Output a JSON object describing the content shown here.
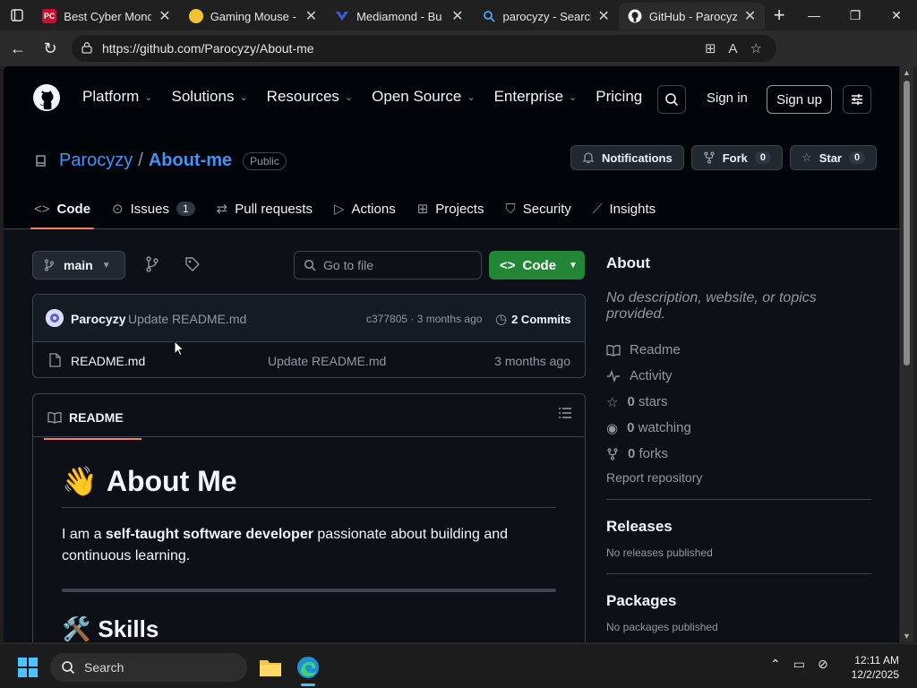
{
  "browser": {
    "tabs": [
      {
        "title": "Best Cyber Mond",
        "favicon": "pc-icon",
        "active": false
      },
      {
        "title": "Gaming Mouse -",
        "favicon": "lemon-icon",
        "active": false
      },
      {
        "title": "Mediamond - Bu",
        "favicon": "mediamond-icon",
        "active": false
      },
      {
        "title": "parocyzy - Search",
        "favicon": "search-icon",
        "active": false
      },
      {
        "title": "GitHub - Parocyz",
        "favicon": "github-icon",
        "active": true
      }
    ],
    "url": "https://github.com/Parocyzy/About-me"
  },
  "header": {
    "nav": [
      "Platform",
      "Solutions",
      "Resources",
      "Open Source",
      "Enterprise",
      "Pricing"
    ],
    "sign_in": "Sign in",
    "sign_up": "Sign up"
  },
  "repo": {
    "owner": "Parocyzy",
    "name": "About-me",
    "visibility": "Public",
    "notifications_label": "Notifications",
    "fork_label": "Fork",
    "fork_count": "0",
    "star_label": "Star",
    "star_count": "0",
    "tabs": [
      {
        "label": "Code",
        "icon": "code-icon",
        "count": ""
      },
      {
        "label": "Issues",
        "icon": "issues-icon",
        "count": "1"
      },
      {
        "label": "Pull requests",
        "icon": "pull-request-icon",
        "count": ""
      },
      {
        "label": "Actions",
        "icon": "play-icon",
        "count": ""
      },
      {
        "label": "Projects",
        "icon": "table-icon",
        "count": ""
      },
      {
        "label": "Security",
        "icon": "shield-icon",
        "count": ""
      },
      {
        "label": "Insights",
        "icon": "graph-icon",
        "count": ""
      }
    ]
  },
  "toolbar": {
    "branch": "main",
    "go_to_file": "Go to file",
    "code_button": "Code"
  },
  "latest_commit": {
    "author": "Parocyzy",
    "message": "Update README.md",
    "hash_age": "c377805 · 3 months ago",
    "commits": "2 Commits"
  },
  "files": [
    {
      "name": "README.md",
      "message": "Update README.md",
      "age": "3 months ago"
    }
  ],
  "readme": {
    "tab_label": "README",
    "h1": "About Me",
    "h1_emoji": "👋",
    "intro_pre": "I am a ",
    "intro_bold": "self-taught software developer",
    "intro_post": " passionate about building and continuous learning.",
    "h2": "Skills",
    "h2_emoji": "🛠️"
  },
  "sidebar": {
    "about_title": "About",
    "description": "No description, website, or topics provided.",
    "readme": "Readme",
    "activity": "Activity",
    "stars_n": "0",
    "stars_label": "stars",
    "watching_n": "0",
    "watching_label": "watching",
    "forks_n": "0",
    "forks_label": "forks",
    "report": "Report repository",
    "releases_title": "Releases",
    "releases_empty": "No releases published",
    "packages_title": "Packages",
    "packages_empty": "No packages published"
  },
  "taskbar": {
    "search_label": "Search",
    "time": "12:11 AM",
    "date": "12/2/2025"
  },
  "colors": {
    "accent_green": "#238636",
    "link_blue": "#4493f8",
    "tab_underline": "#f78166",
    "page_bg": "#0d1117"
  }
}
